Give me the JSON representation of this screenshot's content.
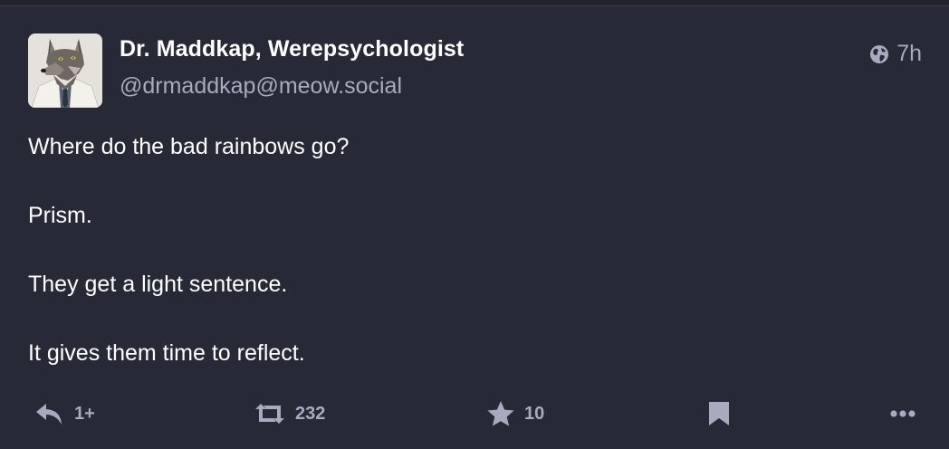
{
  "post": {
    "author": {
      "display_name": "Dr. Maddkap, Werepsychologist",
      "handle": "@drmaddkap@meow.social",
      "avatar_icon": "wolf-avatar-icon"
    },
    "visibility_icon": "globe-icon",
    "timestamp": "7h",
    "content": {
      "lines": [
        "Where do the bad rainbows go?",
        "Prism.",
        "They get a light sentence.",
        "It gives them time to reflect."
      ]
    },
    "actions": {
      "reply": {
        "icon": "reply-icon",
        "count": "1+"
      },
      "boost": {
        "icon": "boost-icon",
        "count": "232"
      },
      "favourite": {
        "icon": "star-icon",
        "count": "10"
      },
      "bookmark": {
        "icon": "bookmark-icon"
      },
      "more": {
        "icon": "more-icon"
      }
    }
  },
  "colors": {
    "background": "#282936",
    "text_primary": "#ffffff",
    "text_secondary": "#a8abbe"
  }
}
